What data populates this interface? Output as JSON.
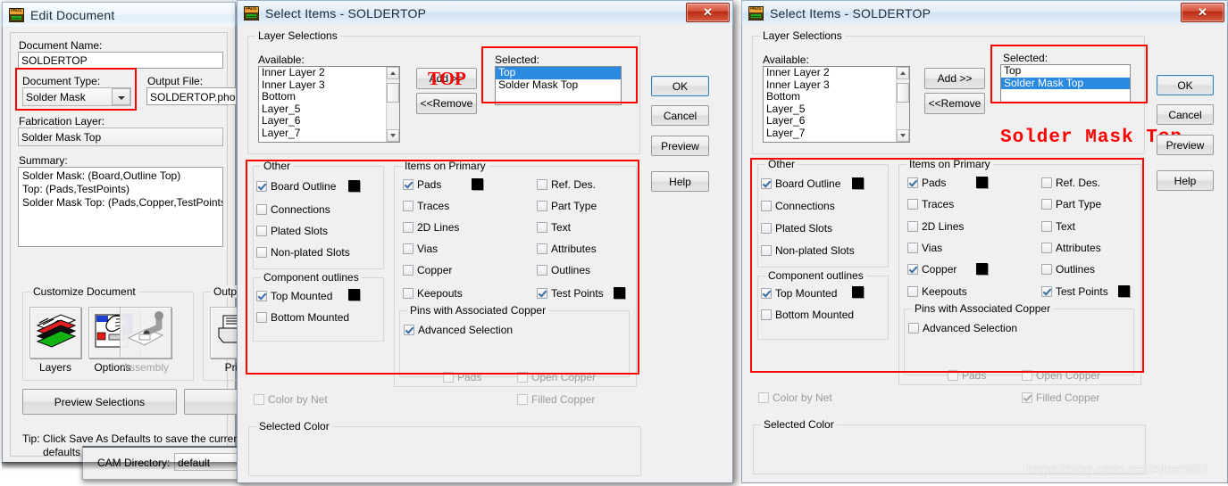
{
  "background": {
    "watermark": "https://blog.csdn.net/Albert992",
    "ghost_line1": "Select Items - SOLDERTOP",
    "ghost_line2": "Document Name"
  },
  "edit_document": {
    "title": "Edit Document",
    "icon": "pads-icon",
    "document_name_label": "Document Name:",
    "document_name_value": "SOLDERTOP",
    "document_type_label": "Document Type:",
    "document_type_value": "Solder Mask",
    "output_file_label": "Output File:",
    "output_file_value": "SOLDERTOP.pho",
    "fabrication_layer_label": "Fabrication Layer:",
    "fabrication_layer_value": "Solder Mask Top",
    "summary_label": "Summary:",
    "summary_lines": [
      "Solder Mask: (Board,Outline Top)",
      "Top: (Pads,TestPoints)",
      "Solder Mask Top: (Pads,Copper,TestPoints)"
    ],
    "customize_group": "Customize Document",
    "output_device_group": "Output Dev",
    "customize_buttons": [
      {
        "label": "Layers",
        "icon": "layers-icon",
        "enabled": true
      },
      {
        "label": "Options",
        "icon": "options-hand-icon",
        "enabled": true
      },
      {
        "label": "Assembly",
        "icon": "assembly-robot-icon",
        "enabled": false
      }
    ],
    "output_buttons": [
      {
        "label": "Print",
        "icon": "printer-icon",
        "enabled": true
      }
    ],
    "preview_selections_button": "Preview Selections",
    "tip_line1": "Tip: Click Save As Defaults to save the current sett",
    "tip_line2": "defaults for this CAM document type and outpu",
    "cam_directory_label": "CAM Directory:",
    "cam_directory_value": "default"
  },
  "dialog_common": {
    "title": "Select Items - SOLDERTOP",
    "close_label": "✕",
    "layer_group": "Layer Selections",
    "available_label": "Available:",
    "selected_label": "Selected:",
    "available_items": [
      "Inner Layer 2",
      "Inner Layer 3",
      "Bottom",
      "Layer_5",
      "Layer_6",
      "Layer_7"
    ],
    "add_button": "Add >>",
    "remove_button": "<<Remove",
    "ok_button": "OK",
    "cancel_button": "Cancel",
    "preview_button": "Preview",
    "help_button": "Help",
    "other_group": "Other",
    "component_outlines_group": "Component outlines",
    "items_on_primary_group": "Items on Primary",
    "pins_copper_group": "Pins with Associated Copper",
    "color_by_net_label": "Color by Net",
    "selected_color_group": "Selected Color"
  },
  "dialog_middle": {
    "annotation": "TOP",
    "selected_items": [
      {
        "label": "Top",
        "selected": true
      },
      {
        "label": "Solder Mask Top",
        "selected": false
      }
    ],
    "other_checks": [
      {
        "label": "Board Outline",
        "checked": true,
        "swatch": "#000000"
      },
      {
        "label": "Connections",
        "checked": false,
        "swatch": null
      },
      {
        "label": "Plated Slots",
        "checked": false,
        "swatch": null
      },
      {
        "label": "Non-plated Slots",
        "checked": false,
        "swatch": null
      }
    ],
    "component_outlines": [
      {
        "label": "Top Mounted",
        "checked": true,
        "swatch": "#000000"
      },
      {
        "label": "Bottom Mounted",
        "checked": false,
        "swatch": null
      }
    ],
    "primary_left": [
      {
        "label": "Pads",
        "checked": true,
        "swatch": "#000000"
      },
      {
        "label": "Traces",
        "checked": false,
        "swatch": null
      },
      {
        "label": "2D Lines",
        "checked": false,
        "swatch": null
      },
      {
        "label": "Vias",
        "checked": false,
        "swatch": null
      },
      {
        "label": "Copper",
        "checked": false,
        "swatch": null
      },
      {
        "label": "Keepouts",
        "checked": false,
        "swatch": null
      }
    ],
    "primary_right": [
      {
        "label": "Ref. Des.",
        "checked": false,
        "swatch": null
      },
      {
        "label": "Part Type",
        "checked": false,
        "swatch": null
      },
      {
        "label": "Text",
        "checked": false,
        "swatch": null
      },
      {
        "label": "Attributes",
        "checked": false,
        "swatch": null
      },
      {
        "label": "Outlines",
        "checked": false,
        "swatch": null
      },
      {
        "label": "Test Points",
        "checked": true,
        "swatch": "#000000"
      }
    ],
    "advanced_selection": {
      "label": "Advanced Selection",
      "checked": true,
      "disabled": false
    },
    "pins_sub": [
      {
        "label": "Pads",
        "checked": false,
        "disabled": true
      },
      {
        "label": "Open Copper",
        "checked": false,
        "disabled": true
      },
      {
        "label": "Filled Copper",
        "checked": false,
        "disabled": true
      }
    ],
    "color_by_net": {
      "checked": false,
      "disabled": true
    }
  },
  "dialog_right": {
    "annotation": "Solder Mask Top",
    "selected_items": [
      {
        "label": "Top",
        "selected": false
      },
      {
        "label": "Solder Mask Top",
        "selected": true
      }
    ],
    "other_checks": [
      {
        "label": "Board Outline",
        "checked": true,
        "swatch": "#000000"
      },
      {
        "label": "Connections",
        "checked": false,
        "swatch": null
      },
      {
        "label": "Plated Slots",
        "checked": false,
        "swatch": null
      },
      {
        "label": "Non-plated Slots",
        "checked": false,
        "swatch": null
      }
    ],
    "component_outlines": [
      {
        "label": "Top Mounted",
        "checked": true,
        "swatch": "#000000"
      },
      {
        "label": "Bottom Mounted",
        "checked": false,
        "swatch": null
      }
    ],
    "primary_left": [
      {
        "label": "Pads",
        "checked": true,
        "swatch": "#000000"
      },
      {
        "label": "Traces",
        "checked": false,
        "swatch": null
      },
      {
        "label": "2D Lines",
        "checked": false,
        "swatch": null
      },
      {
        "label": "Vias",
        "checked": false,
        "swatch": null
      },
      {
        "label": "Copper",
        "checked": true,
        "swatch": "#000000"
      },
      {
        "label": "Keepouts",
        "checked": false,
        "swatch": null
      }
    ],
    "primary_right": [
      {
        "label": "Ref. Des.",
        "checked": false,
        "swatch": null
      },
      {
        "label": "Part Type",
        "checked": false,
        "swatch": null
      },
      {
        "label": "Text",
        "checked": false,
        "swatch": null
      },
      {
        "label": "Attributes",
        "checked": false,
        "swatch": null
      },
      {
        "label": "Outlines",
        "checked": false,
        "swatch": null
      },
      {
        "label": "Test Points",
        "checked": true,
        "swatch": "#000000"
      }
    ],
    "advanced_selection": {
      "label": "Advanced Selection",
      "checked": false,
      "disabled": false
    },
    "pins_sub": [
      {
        "label": "Pads",
        "checked": false,
        "disabled": true
      },
      {
        "label": "Open Copper",
        "checked": false,
        "disabled": true
      },
      {
        "label": "Filled Copper",
        "checked": true,
        "disabled": true
      }
    ],
    "color_by_net": {
      "checked": false,
      "disabled": true
    }
  }
}
